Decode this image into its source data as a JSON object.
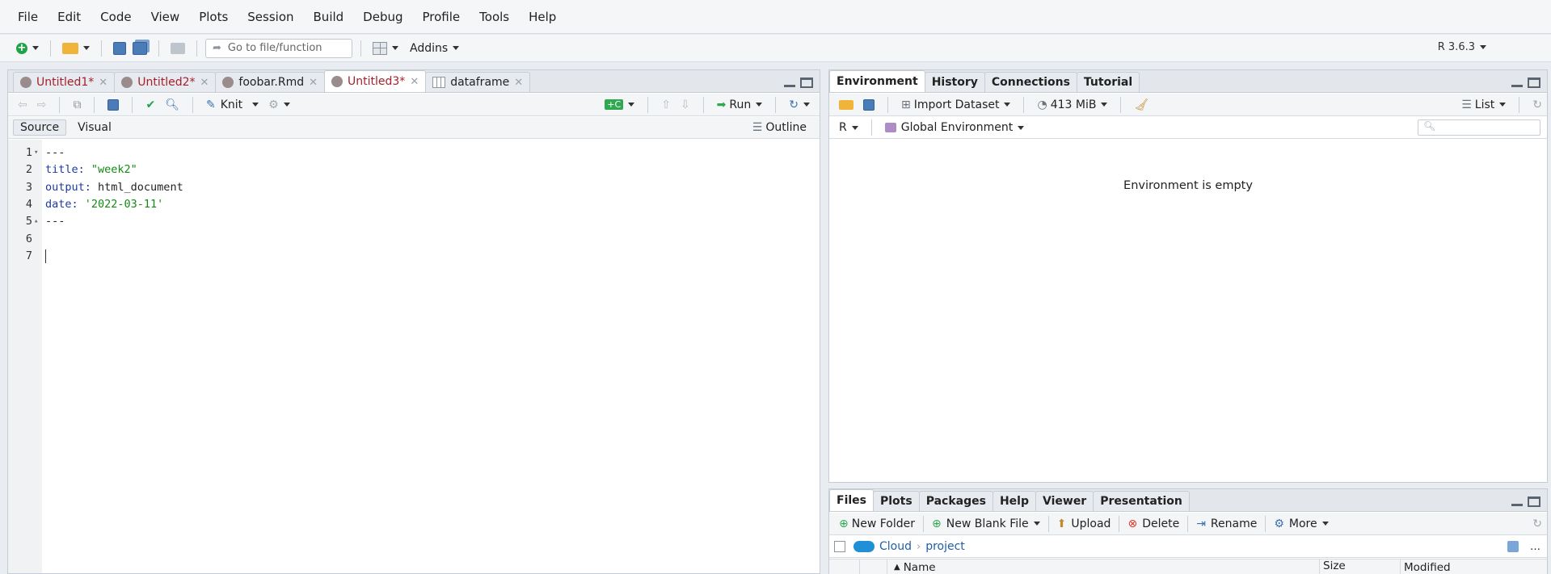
{
  "menu": [
    "File",
    "Edit",
    "Code",
    "View",
    "Plots",
    "Session",
    "Build",
    "Debug",
    "Profile",
    "Tools",
    "Help"
  ],
  "toolbar": {
    "goto_placeholder": "Go to file/function",
    "addins_label": "Addins",
    "r_version": "R 3.6.3"
  },
  "editor": {
    "tabs": [
      {
        "label": "Untitled1*",
        "modified": true,
        "icon": "rmd-icon"
      },
      {
        "label": "Untitled2*",
        "modified": true,
        "icon": "rmd-icon"
      },
      {
        "label": "foobar.Rmd",
        "modified": false,
        "icon": "rmd-icon"
      },
      {
        "label": "Untitled3*",
        "modified": true,
        "icon": "rmd-icon",
        "active": true
      },
      {
        "label": "dataframe",
        "modified": false,
        "icon": "dataframe-icon"
      }
    ],
    "knit_label": "Knit",
    "run_label": "Run",
    "source_label": "Source",
    "visual_label": "Visual",
    "outline_label": "Outline",
    "lines": [
      {
        "num": "1",
        "parts": [
          {
            "c": "---",
            "cls": ""
          }
        ]
      },
      {
        "num": "2",
        "parts": [
          {
            "c": "title:",
            "cls": "k"
          },
          {
            "c": " \"week2\"",
            "cls": "s"
          }
        ]
      },
      {
        "num": "3",
        "parts": [
          {
            "c": "output:",
            "cls": "k"
          },
          {
            "c": " html_document",
            "cls": ""
          }
        ]
      },
      {
        "num": "4",
        "parts": [
          {
            "c": "date:",
            "cls": "k"
          },
          {
            "c": " '2022-03-11'",
            "cls": "s"
          }
        ]
      },
      {
        "num": "5",
        "parts": [
          {
            "c": "---",
            "cls": ""
          }
        ]
      },
      {
        "num": "6",
        "parts": []
      },
      {
        "num": "7",
        "parts": []
      }
    ]
  },
  "env": {
    "tabs": [
      "Environment",
      "History",
      "Connections",
      "Tutorial"
    ],
    "import_label": "Import Dataset",
    "memory": "413 MiB",
    "list_label": "List",
    "lang": "R",
    "scope": "Global Environment",
    "empty_msg": "Environment is empty"
  },
  "files": {
    "tabs": [
      "Files",
      "Plots",
      "Packages",
      "Help",
      "Viewer",
      "Presentation"
    ],
    "new_folder": "New Folder",
    "new_blank": "New Blank File",
    "upload": "Upload",
    "delete": "Delete",
    "rename": "Rename",
    "more": "More",
    "crumb_root": "Cloud",
    "crumb_dir": "project",
    "col_name": "Name",
    "col_size": "Size",
    "col_modified": "Modified"
  },
  "colors": {
    "modified_tab": "#a4212b",
    "keyword": "#1e3aa0",
    "string": "#108a10",
    "link": "#1f5fa8"
  }
}
